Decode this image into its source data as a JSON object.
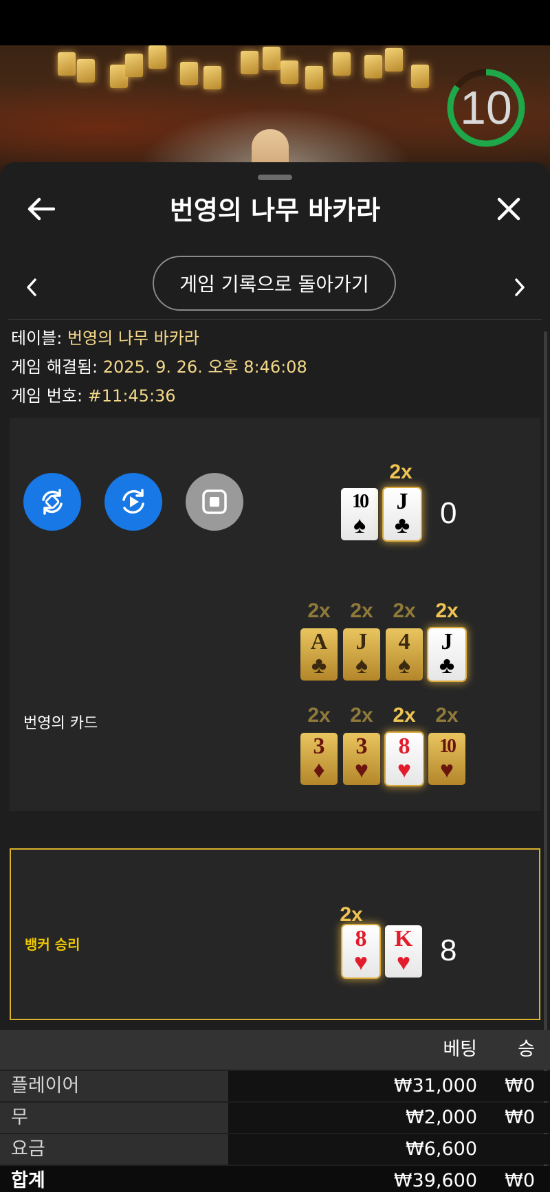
{
  "timer": {
    "value": "10",
    "remaining_fraction": 0.85,
    "color": "#1fa84a"
  },
  "header": {
    "title": "번영의 나무 바카라"
  },
  "nav": {
    "history_button": "게임 기록으로 돌아가기"
  },
  "info": {
    "table_label": "테이블: ",
    "table_value": "번영의 나무 바카라",
    "resolved_label": "게임 해결됨: ",
    "resolved_value": "2025. 9. 26. 오후 8:46:08",
    "number_label": "게임 번호: ",
    "number_value": "#11:45:36"
  },
  "player": {
    "score": "0",
    "multiplier": "2x",
    "cards": [
      {
        "rank": "10",
        "suit": "♠",
        "color": "black"
      },
      {
        "rank": "J",
        "suit": "♣",
        "color": "black"
      }
    ]
  },
  "prosperity": {
    "label": "번영의 카드",
    "row1": {
      "multipliers": [
        "2x",
        "2x",
        "2x",
        "2x"
      ],
      "cards": [
        {
          "rank": "A",
          "suit": "♣",
          "color": "black"
        },
        {
          "rank": "J",
          "suit": "♠",
          "color": "black"
        },
        {
          "rank": "4",
          "suit": "♠",
          "color": "black"
        },
        {
          "rank": "J",
          "suit": "♣",
          "color": "black"
        }
      ]
    },
    "row2": {
      "multipliers": [
        "2x",
        "2x",
        "2x",
        "2x"
      ],
      "cards": [
        {
          "rank": "3",
          "suit": "♦",
          "color": "red"
        },
        {
          "rank": "3",
          "suit": "♥",
          "color": "red"
        },
        {
          "rank": "8",
          "suit": "♥",
          "color": "red"
        },
        {
          "rank": "10",
          "suit": "♥",
          "color": "red"
        }
      ]
    }
  },
  "banker": {
    "result": "뱅커 승리",
    "score": "8",
    "multiplier": "2x",
    "cards": [
      {
        "rank": "8",
        "suit": "♥",
        "color": "red"
      },
      {
        "rank": "K",
        "suit": "♥",
        "color": "red"
      }
    ]
  },
  "bets": {
    "col_bet": "베팅",
    "col_win": "승",
    "rows": [
      {
        "label": "플레이어",
        "bet": "₩31,000",
        "win": "₩0"
      },
      {
        "label": "무",
        "bet": "₩2,000",
        "win": "₩0"
      },
      {
        "label": "요금",
        "bet": "₩6,600",
        "win": ""
      }
    ],
    "total": {
      "label": "합계",
      "bet": "₩39,600",
      "win": "₩0"
    }
  },
  "colors": {
    "accent_gold": "#f0c452",
    "banker_border": "#d9b12c",
    "control_blue": "#1778e6"
  }
}
